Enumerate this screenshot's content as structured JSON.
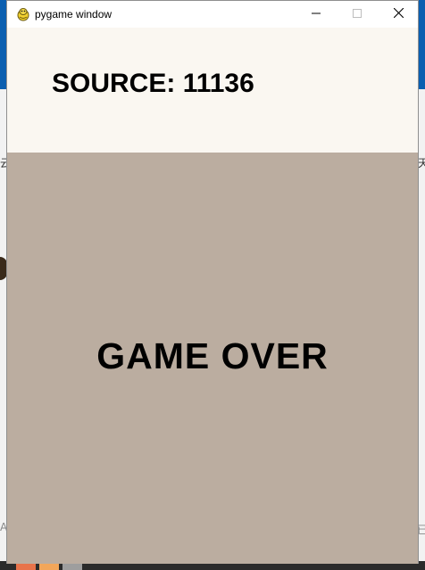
{
  "window": {
    "title": "pygame window",
    "icon": "pygame-snake-icon",
    "controls": [
      "minimize-icon",
      "maximize-icon",
      "close-icon"
    ]
  },
  "game": {
    "score_label": "SOURCE:",
    "score_value": "11136",
    "status_text": "GAME OVER"
  },
  "colors": {
    "score_panel_bg": "#faf7f1",
    "board_bg": "#bbada0",
    "text": "#000000"
  },
  "desktop": {
    "left_glyph": "云",
    "right_glyph": "天",
    "bottom_left_glyph": "A",
    "bottom_right_glyph": "已"
  }
}
